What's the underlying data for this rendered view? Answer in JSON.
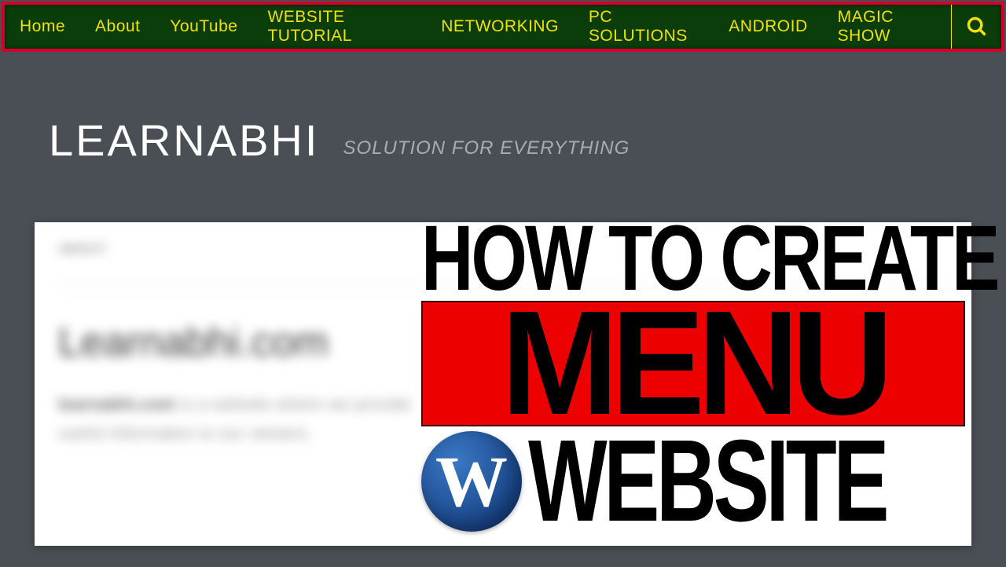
{
  "nav": {
    "items": [
      {
        "label": "Home"
      },
      {
        "label": "About"
      },
      {
        "label": "YouTube"
      },
      {
        "label": "WEBSITE TUTORIAL"
      },
      {
        "label": "NETWORKING"
      },
      {
        "label": "PC SOLUTIONS"
      },
      {
        "label": "ANDROID"
      },
      {
        "label": "MAGIC SHOW"
      }
    ]
  },
  "header": {
    "title": "LEARNABHI",
    "tagline": "SOLUTION FOR EVERYTHING"
  },
  "content": {
    "about_label": "ABOUT",
    "domain_title": "Learnabhi.com",
    "body_bold": "learnabhi.com",
    "body_rest": " is a website where we provide useful information to our viewers."
  },
  "thumbnail": {
    "line1": "HOW TO CREATE",
    "line2": "MENU",
    "line3": "WEBSITE",
    "wp_glyph": "W"
  }
}
